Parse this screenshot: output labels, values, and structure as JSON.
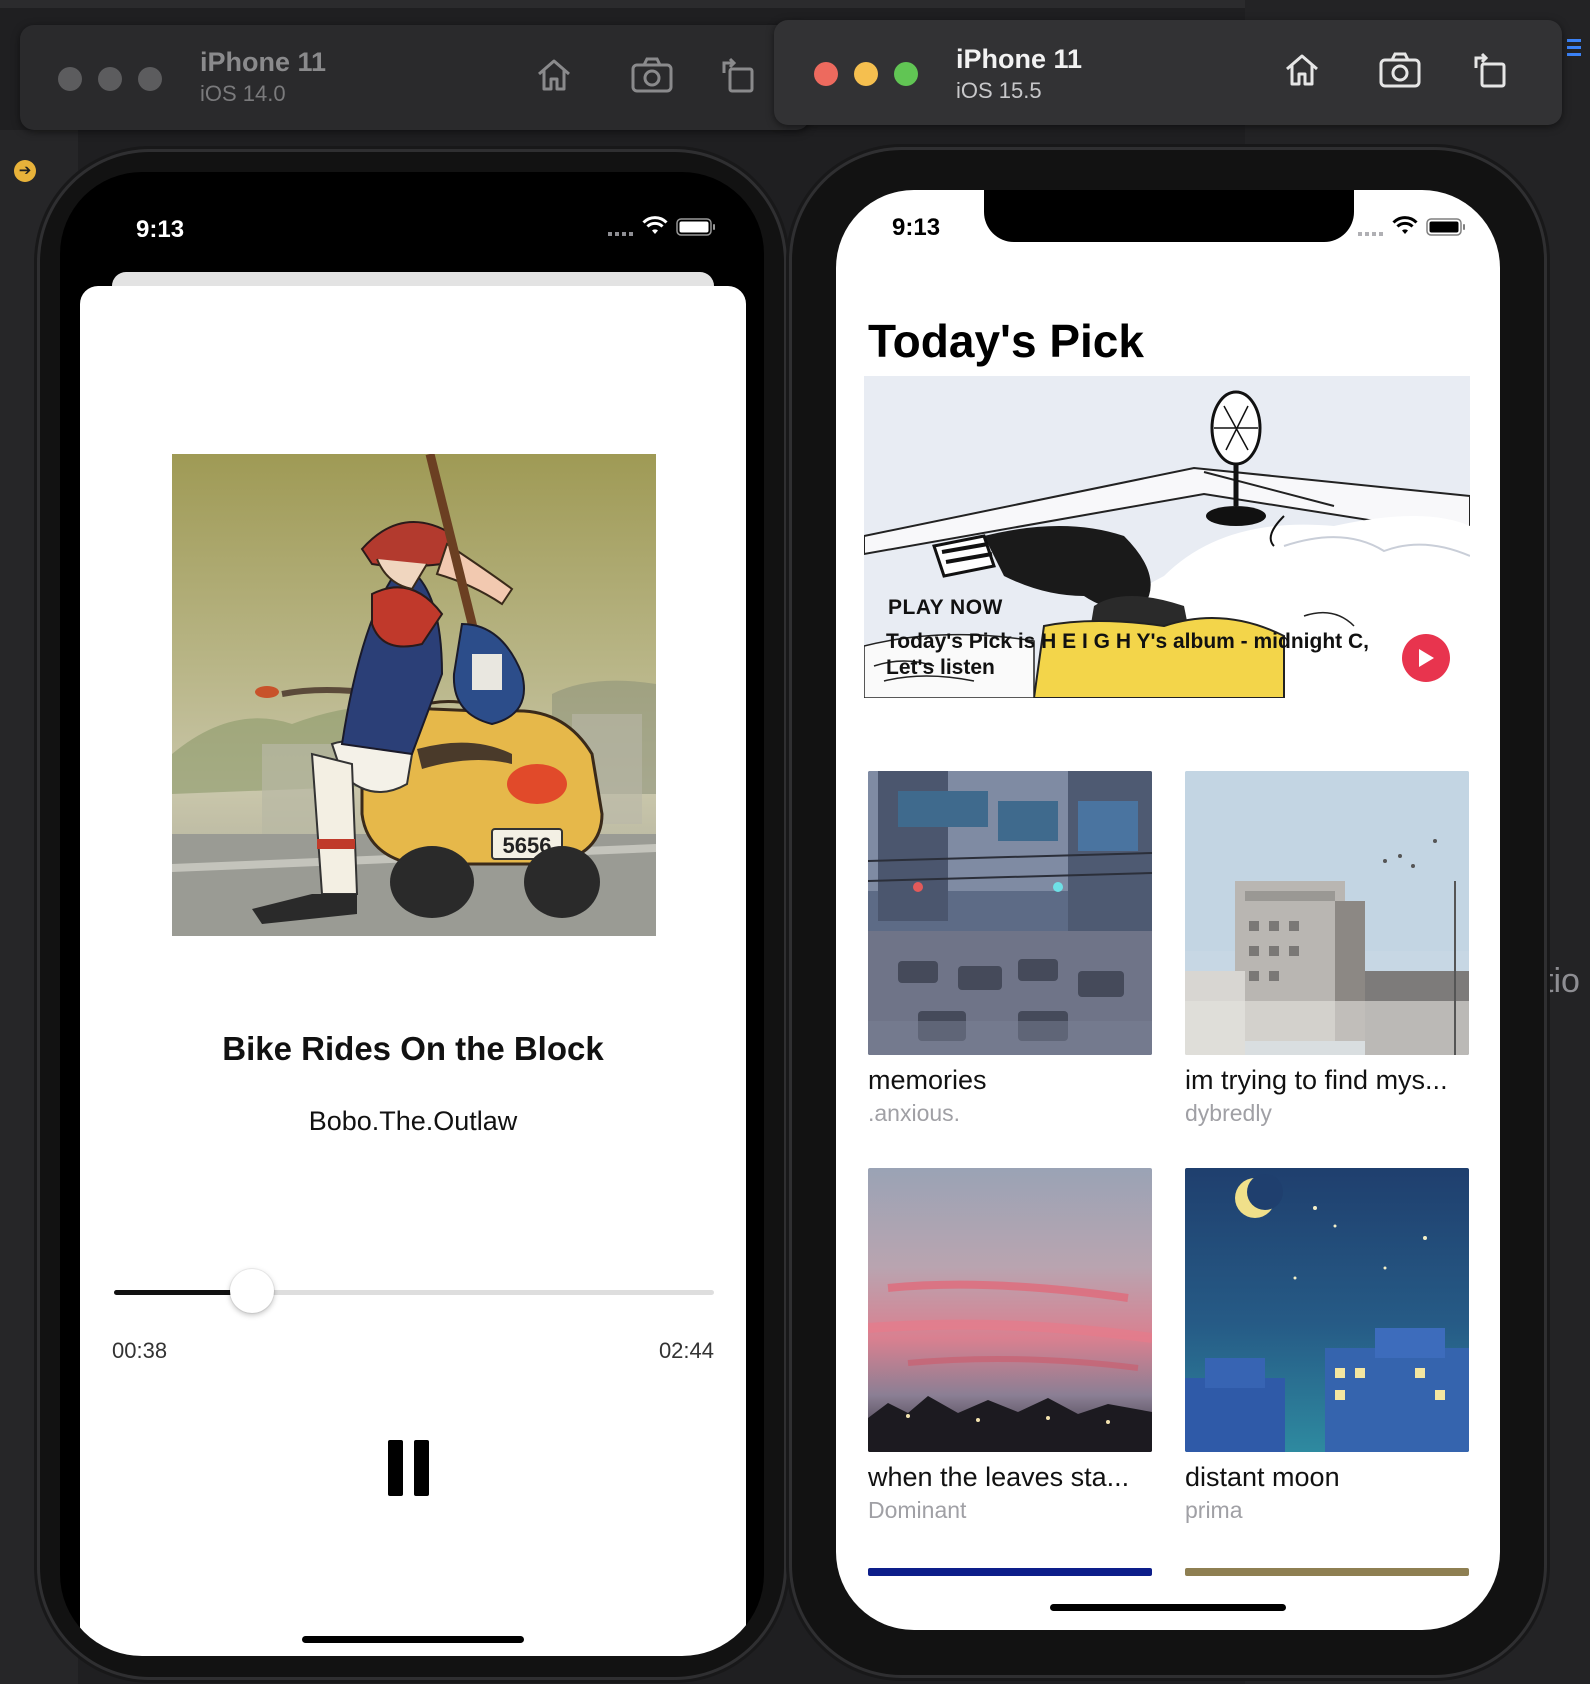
{
  "simulators": [
    {
      "device": "iPhone 11",
      "os": "iOS 14.0",
      "status_time": "9:13",
      "player": {
        "title": "Bike Rides On the Block",
        "artist": "Bobo.The.Outlaw",
        "elapsed": "00:38",
        "duration": "02:44",
        "progress_fraction": 0.23,
        "plate_number": "5656"
      }
    },
    {
      "device": "iPhone 11",
      "os": "iOS 15.5",
      "status_time": "9:13",
      "home": {
        "heading": "Today's Pick",
        "featured": {
          "kicker": "PLAY NOW",
          "description": "Today's Pick is H E I G H Y's album - midnight C, Let's listen"
        },
        "albums": [
          {
            "title": "memories",
            "artist": ".anxious."
          },
          {
            "title": "im trying to find mys...",
            "artist": "dybredly"
          },
          {
            "title": "when the leaves sta...",
            "artist": "Dominant"
          },
          {
            "title": "distant moon",
            "artist": "prima"
          }
        ]
      }
    }
  ],
  "desktop": {
    "partial_label": "tio"
  },
  "colors": {
    "traffic_red": "#ed6a5e",
    "traffic_yellow": "#f5bf4f",
    "traffic_green": "#61c554",
    "inactive_dot": "#5c5c5e",
    "play_accent": "#e8344e"
  },
  "icons": [
    "home-icon",
    "screenshot-icon",
    "rotate-icon",
    "wifi-icon",
    "cellular-icon",
    "battery-icon",
    "pause-icon",
    "play-icon",
    "arrow-right-icon"
  ]
}
